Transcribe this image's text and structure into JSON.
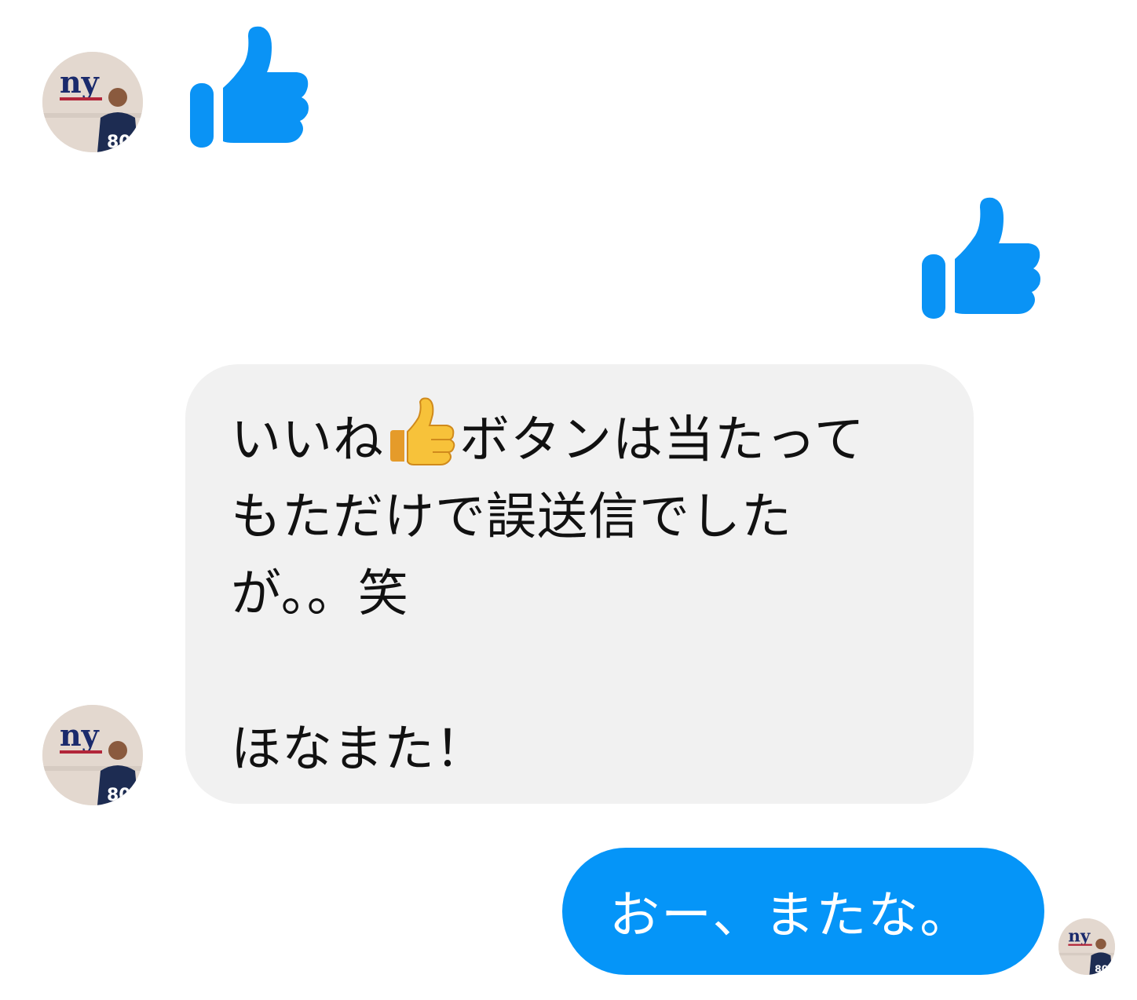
{
  "conversation": {
    "messages": [
      {
        "sender": "contact",
        "type": "like-sticker"
      },
      {
        "sender": "me",
        "type": "like-sticker"
      },
      {
        "sender": "contact",
        "type": "text",
        "lines": [
          {
            "before_emoji": "いいね",
            "emoji": "thumbs-up-emoji",
            "after_emoji": "ボタンは当たって"
          },
          {
            "text": "もただけで誤送信でした"
          },
          {
            "text": "が。。笑"
          },
          {
            "text": "ほなまた！"
          }
        ]
      },
      {
        "sender": "me",
        "type": "text",
        "text": "おー、またな。"
      }
    ]
  },
  "colors": {
    "like_blue": "#0a93f5",
    "incoming_bubble": "#f1f1f1",
    "outgoing_bubble": "#0595f8",
    "incoming_text": "#111111",
    "outgoing_text": "#ffffff"
  },
  "icons": {
    "like": "thumbs-up-icon",
    "avatar": "user-avatar"
  }
}
